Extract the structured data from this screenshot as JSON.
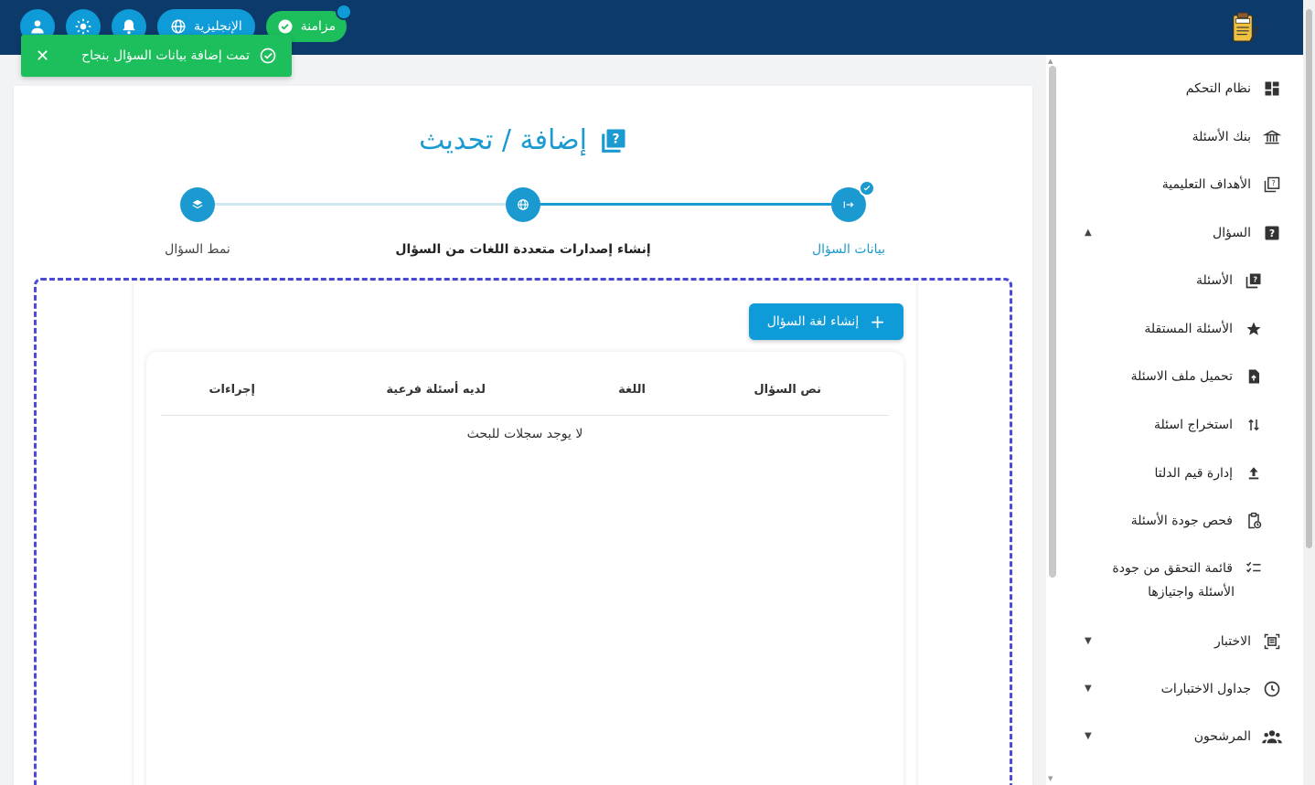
{
  "topbar": {
    "sync_label": "مزامنة",
    "language_label": "الإنجليزية"
  },
  "toast": {
    "message": "تمت إضافة بيانات السؤال بنجاح"
  },
  "page": {
    "title": "إضافة / تحديث"
  },
  "stepper": {
    "steps": [
      {
        "label": "بيانات السؤال",
        "state": "completed"
      },
      {
        "label": "إنشاء إصدارات متعددة اللغات من السؤال",
        "state": "active"
      },
      {
        "label": "نمط السؤال",
        "state": "pending"
      }
    ]
  },
  "panel": {
    "create_button": "إنشاء لغة السؤال",
    "table": {
      "columns": [
        "نص السؤال",
        "اللغة",
        "لديه أسئلة فرعية",
        "إجراءات"
      ],
      "empty_text": "لا يوجد سجلات للبحث"
    }
  },
  "sidebar": {
    "items": [
      {
        "label": "نظام التحكم",
        "icon": "dashboard-icon"
      },
      {
        "label": "بنك الأسئلة",
        "icon": "bank-icon"
      },
      {
        "label": "الأهداف التعليمية",
        "icon": "objectives-icon"
      },
      {
        "label": "السؤال",
        "icon": "question-icon",
        "expanded": true
      },
      {
        "label": "الأسئلة",
        "icon": "questions-icon"
      },
      {
        "label": "الأسئلة المستقلة",
        "icon": "star-icon"
      },
      {
        "label": "تحميل ملف الاسئلة",
        "icon": "file-upload-icon"
      },
      {
        "label": "استخراج اسئلة",
        "icon": "sort-icon"
      },
      {
        "label": "إدارة قيم الدلتا",
        "icon": "upload-icon"
      },
      {
        "label": "فحص جودة الأسئلة",
        "icon": "clipboard-clock-icon"
      },
      {
        "label": "قائمة التحقق من جودة",
        "icon": "checklist-icon"
      },
      {
        "label": "الأسئلة واجتيازها"
      },
      {
        "label": "الاختبار",
        "icon": "exam-icon"
      },
      {
        "label": "جداول الاختبارات",
        "icon": "clock-icon"
      },
      {
        "label": "المرشحون",
        "icon": "people-icon"
      }
    ]
  },
  "colors": {
    "topbar": "#0c3a6b",
    "accent": "#1a9ad0",
    "success": "#1cbf5c",
    "dashed": "#4a4ad6"
  }
}
